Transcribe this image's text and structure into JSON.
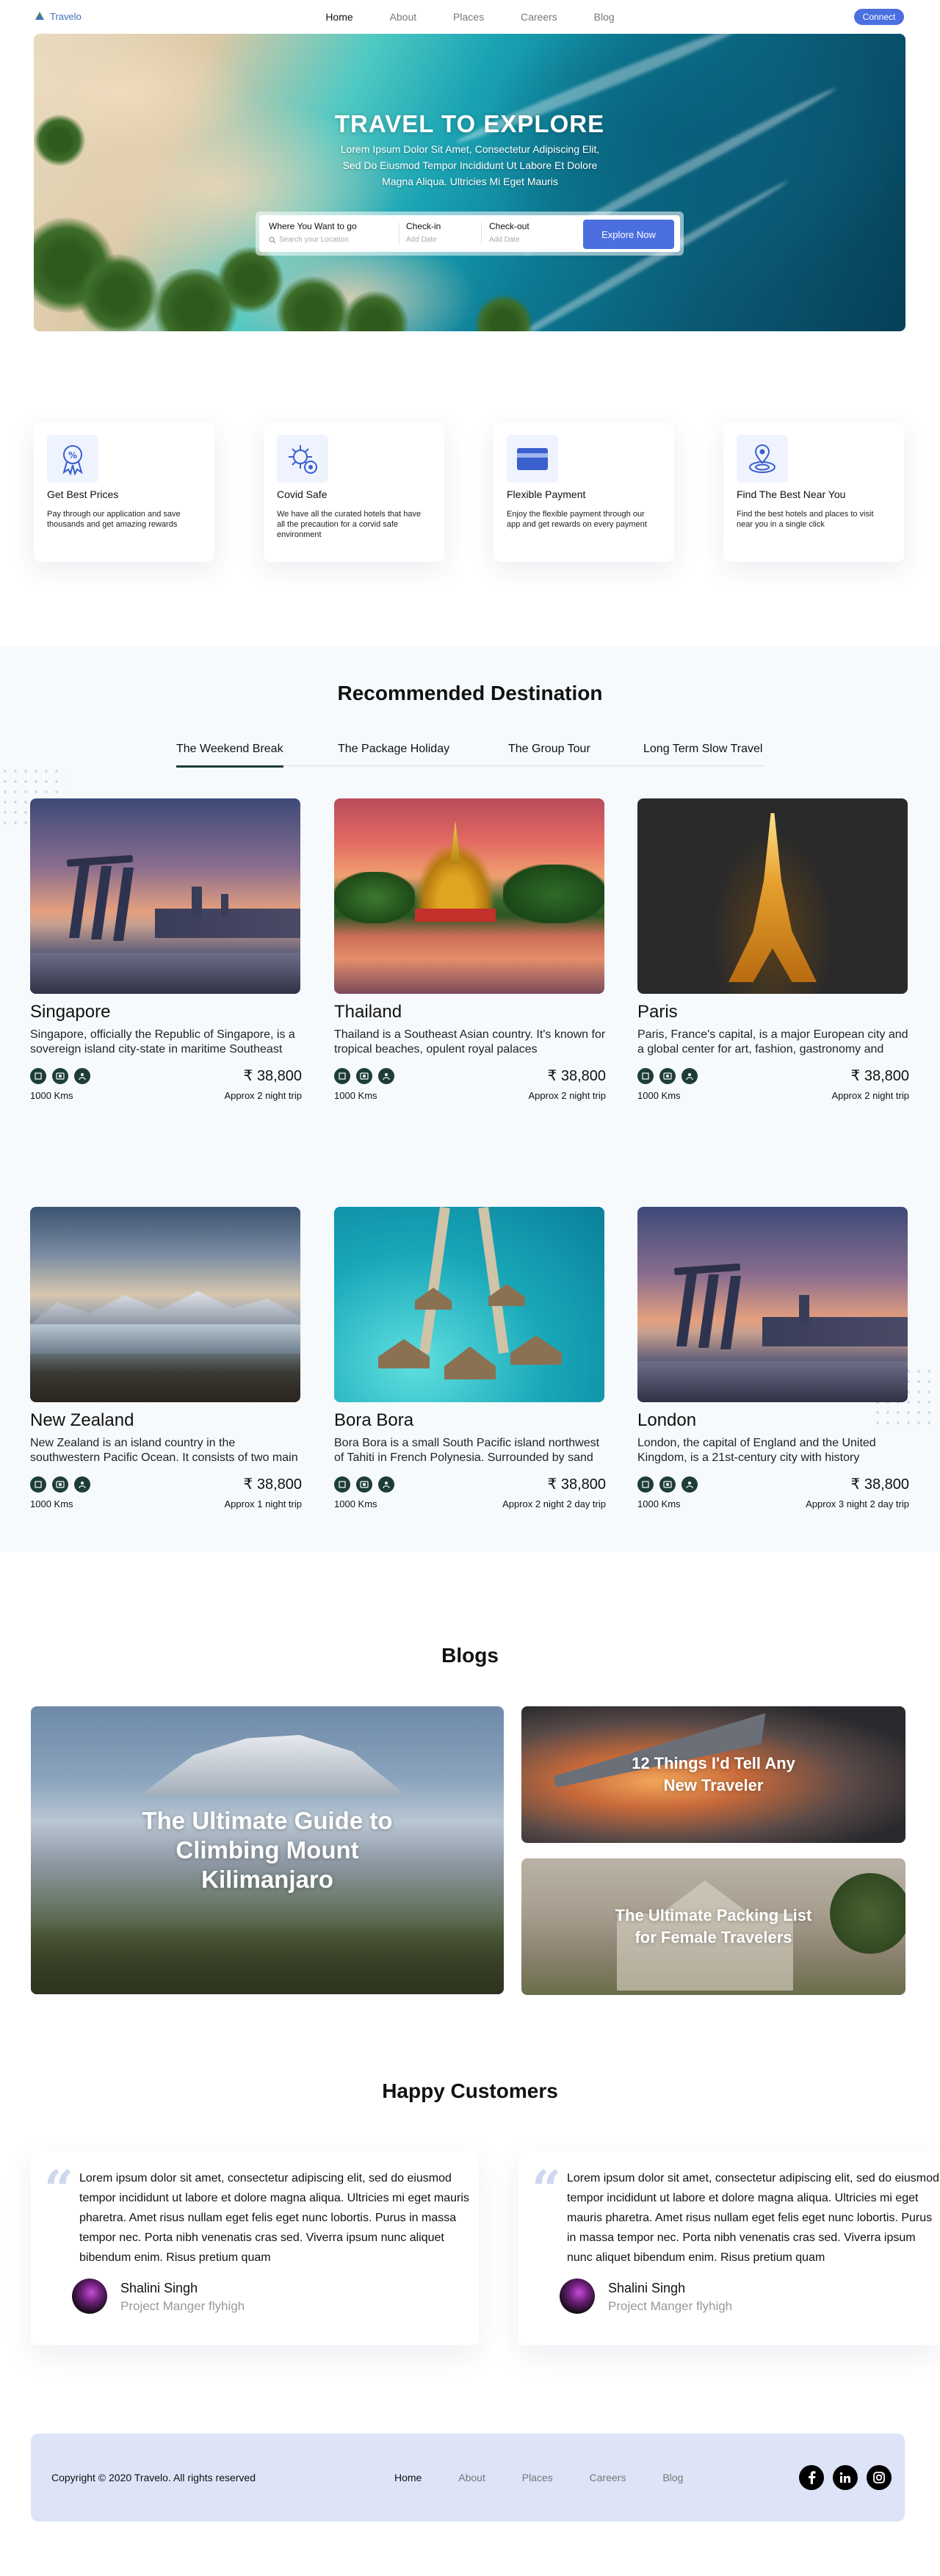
{
  "brand": {
    "name": "Travelo"
  },
  "nav": {
    "links": [
      "Home",
      "About",
      "Places",
      "Careers",
      "Blog"
    ],
    "connect_label": "Connect"
  },
  "hero": {
    "title": "TRAVEL TO EXPLORE",
    "subtitle": "Lorem Ipsum Dolor Sit Amet, Consectetur Adipiscing Elit, Sed Do Eiusmod Tempor Incididunt Ut Labore Et Dolore Magna Aliqua. Ultricies Mi Eget Mauris",
    "search": {
      "where_label": "Where You Want to go",
      "where_placeholder": "Search your Location",
      "checkin_label": "Check-in",
      "checkin_placeholder": "Add Date",
      "checkout_label": "Check-out",
      "checkout_placeholder": "Add Date",
      "button_label": "Explore Now"
    }
  },
  "features": [
    {
      "icon": "discount-badge-icon",
      "title": "Get Best Prices",
      "text": "Pay through our application and save thousands and get amazing rewards"
    },
    {
      "icon": "virus-safe-icon",
      "title": "Covid Safe",
      "text": "We have all the curated hotels that have all the precaution for a corvid safe environment"
    },
    {
      "icon": "credit-card-icon",
      "title": "Flexible Payment",
      "text": "Enjoy the flexible payment through our app and get rewards on every payment"
    },
    {
      "icon": "location-pin-icon",
      "title": "Find The Best Near You",
      "text": "Find the best hotels and places to visit near you in a single click"
    }
  ],
  "recommended": {
    "title": "Recommended Destination",
    "tabs": [
      "The Weekend Break",
      "The Package Holiday",
      "The Group Tour",
      "Long Term Slow Travel"
    ],
    "active_tab": "The Weekend Break",
    "destinations": [
      {
        "name": "Singapore",
        "desc": "Singapore, officially the Republic of Singapore, is a sovereign island city-state in maritime Southeast",
        "price": "₹ 38,800",
        "distance": "1000 Kms",
        "duration": "Approx 2 night trip"
      },
      {
        "name": "Thailand",
        "desc": "Thailand is a Southeast Asian country. It's known for tropical beaches, opulent royal palaces",
        "price": "₹ 38,800",
        "distance": "1000 Kms",
        "duration": "Approx 2 night trip"
      },
      {
        "name": "Paris",
        "desc": "Paris, France's capital, is a major European city and a global center for art, fashion, gastronomy and",
        "price": "₹ 38,800",
        "distance": "1000 Kms",
        "duration": "Approx 2 night trip"
      },
      {
        "name": "New Zealand",
        "desc": "New Zealand is an island country in the southwestern Pacific Ocean. It consists of two main",
        "price": "₹ 38,800",
        "distance": "1000 Kms",
        "duration": "Approx 1 night trip"
      },
      {
        "name": "Bora Bora",
        "desc": "Bora Bora is a small South Pacific island northwest of Tahiti in French Polynesia. Surrounded by sand",
        "price": "₹ 38,800",
        "distance": "1000 Kms",
        "duration": "Approx 2 night 2 day trip"
      },
      {
        "name": "London",
        "desc": "London, the capital of England and the United Kingdom, is a 21st-century city with history",
        "price": "₹ 38,800",
        "distance": "1000 Kms",
        "duration": "Approx 3 night 2 day trip"
      }
    ]
  },
  "blogs": {
    "title": "Blogs",
    "posts": [
      "The Ultimate Guide to Climbing Mount Kilimanjaro",
      "12 Things I'd Tell Any New Traveler",
      "The Ultimate Packing List for Female Travelers"
    ]
  },
  "testimonials": {
    "title": "Happy Customers",
    "items": [
      {
        "text": "Lorem ipsum dolor sit amet, consectetur adipiscing elit, sed do eiusmod tempor incididunt ut labore et dolore magna aliqua. Ultricies mi eget mauris pharetra. Amet risus nullam eget felis eget nunc lobortis. Purus in massa tempor nec. Porta nibh venenatis cras sed. Viverra ipsum nunc aliquet bibendum enim. Risus pretium quam",
        "name": "Shalini Singh",
        "role": "Project Manger flyhigh"
      },
      {
        "text": "Lorem ipsum dolor sit amet, consectetur adipiscing elit, sed do eiusmod tempor incididunt ut labore et dolore magna aliqua. Ultricies mi eget mauris pharetra. Amet risus nullam eget felis eget nunc lobortis. Purus in massa tempor nec. Porta nibh venenatis cras sed. Viverra ipsum nunc aliquet bibendum enim. Risus pretium quam",
        "name": "Shalini Singh",
        "role": "Project Manger flyhigh"
      }
    ]
  },
  "footer": {
    "copyright": "Copyright © 2020 Travelo. All rights reserved",
    "links": [
      "Home",
      "About",
      "Places",
      "Careers",
      "Blog"
    ],
    "social": [
      "facebook-icon",
      "linkedin-icon",
      "instagram-icon"
    ]
  },
  "colors": {
    "accent": "#4c6fe0",
    "dark_green": "#1e3d36",
    "footer_bg": "#dde4f8"
  }
}
